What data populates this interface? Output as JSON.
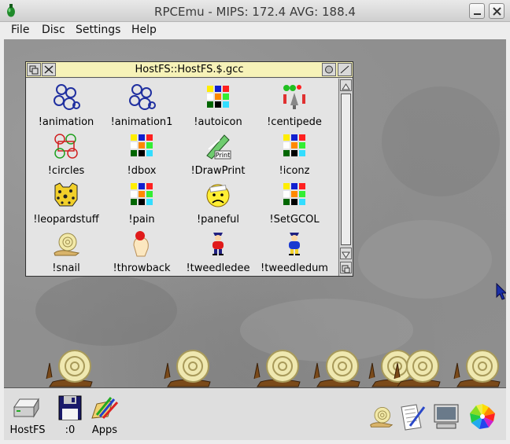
{
  "window": {
    "title": "RPCEmu - MIPS: 172.4 AVG: 188.4",
    "app_icon": "green-acorn-logo"
  },
  "menubar": {
    "items": [
      "File",
      "Disc",
      "Settings",
      "Help"
    ]
  },
  "filer": {
    "title": "HostFS::HostFS.$.gcc",
    "items": [
      {
        "label": "!animation",
        "icon": "circles-blue-icon"
      },
      {
        "label": "!animation1",
        "icon": "circles-blue-icon"
      },
      {
        "label": "!autoicon",
        "icon": "color-grid-icon"
      },
      {
        "label": "!centipede",
        "icon": "centipede-icon"
      },
      {
        "label": "!circles",
        "icon": "circles-color-icon"
      },
      {
        "label": "!dbox",
        "icon": "color-grid-icon"
      },
      {
        "label": "!DrawPrint",
        "icon": "drawprint-icon"
      },
      {
        "label": "!iconz",
        "icon": "color-grid-icon"
      },
      {
        "label": "!leopardstuff",
        "icon": "leopard-icon"
      },
      {
        "label": "!pain",
        "icon": "color-grid-icon"
      },
      {
        "label": "!paneful",
        "icon": "sad-face-icon"
      },
      {
        "label": "!SetGCOL",
        "icon": "color-grid-icon"
      },
      {
        "label": "!snail",
        "icon": "snail-icon"
      },
      {
        "label": "!throwback",
        "icon": "throwback-icon"
      },
      {
        "label": "!tweedledee",
        "icon": "tweedle-icon"
      },
      {
        "label": "!tweedledum",
        "icon": "tweedle-icon"
      }
    ],
    "drawprint_badge": "Print"
  },
  "iconbar": {
    "left": [
      {
        "label": "HostFS",
        "icon": "hard-drive-icon"
      },
      {
        "label": ":0",
        "icon": "floppy-disk-icon"
      },
      {
        "label": "Apps",
        "icon": "apps-icon"
      }
    ],
    "right": [
      {
        "icon": "snail-icon"
      },
      {
        "icon": "edit-icon"
      },
      {
        "icon": "display-icon"
      },
      {
        "icon": "task-manager-icon"
      }
    ]
  },
  "colors": {
    "filer_title_bg": "#f6f2b8",
    "desktop": "#8f8f8f"
  }
}
